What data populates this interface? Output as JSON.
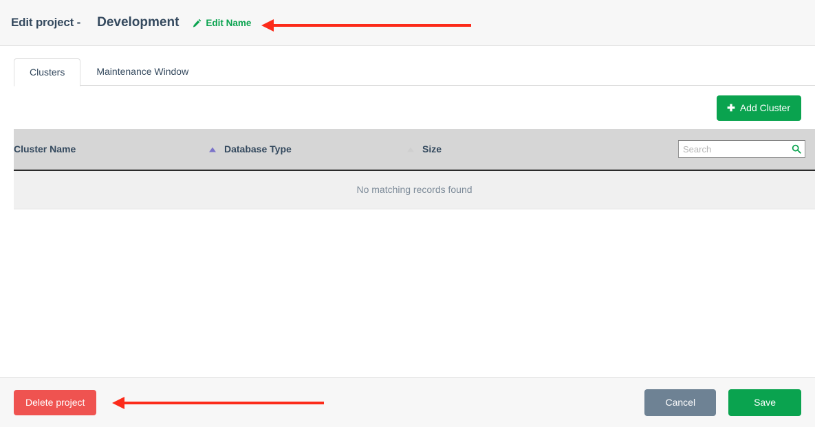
{
  "header": {
    "title_prefix": "Edit project -",
    "project_name": "Development",
    "edit_name_label": "Edit Name",
    "pencil_icon": "pencil-icon"
  },
  "tabs": [
    {
      "label": "Clusters",
      "active": true
    },
    {
      "label": "Maintenance Window",
      "active": false
    }
  ],
  "toolbar": {
    "add_cluster_label": "Add Cluster",
    "add_cluster_icon": "plus-icon"
  },
  "table": {
    "columns": [
      {
        "label": "Cluster Name",
        "sort": "ascending"
      },
      {
        "label": "Database Type",
        "sort": "none"
      },
      {
        "label": "Size",
        "sort": "none"
      }
    ],
    "empty_message": "No matching records found",
    "rows": []
  },
  "search": {
    "placeholder": "Search",
    "value": "",
    "icon": "search-icon"
  },
  "footer": {
    "delete_label": "Delete project",
    "cancel_label": "Cancel",
    "save_label": "Save"
  },
  "annotations": [
    {
      "name": "arrow-to-edit-name",
      "target": "Edit Name"
    },
    {
      "name": "arrow-to-delete-project",
      "target": "Delete project"
    }
  ],
  "colors": {
    "green": "#0aa34f",
    "red": "#ef5350",
    "slate": "#6e8294",
    "header_text": "#34495e",
    "annotation_red": "#fc2b1a",
    "table_header_bg": "#d6d6d6",
    "empty_row_bg": "#f0f0f0"
  }
}
